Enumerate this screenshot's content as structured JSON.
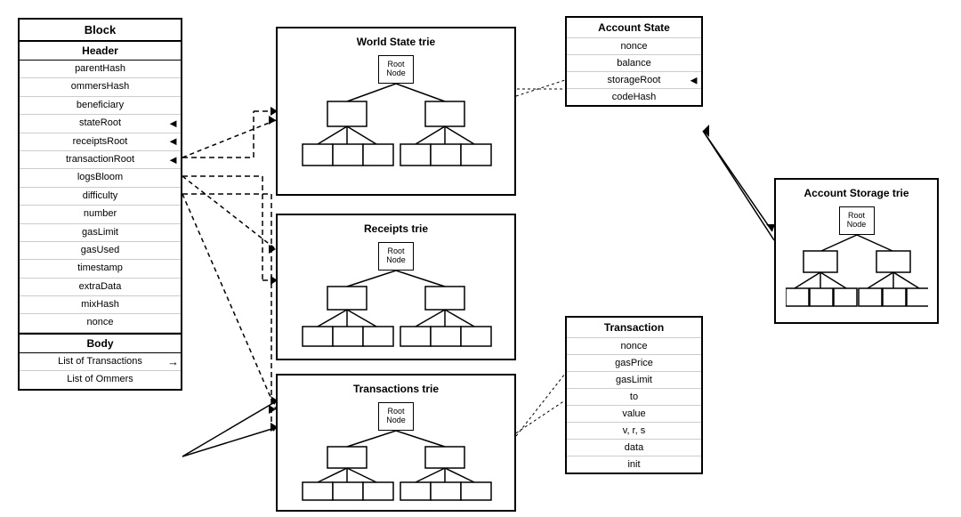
{
  "block": {
    "title": "Block",
    "header": {
      "label": "Header",
      "fields": [
        "parentHash",
        "ommersHash",
        "beneficiary",
        "stateRoot",
        "receiptsRoot",
        "transactionRoot",
        "logsBloom",
        "difficulty",
        "number",
        "gasLimit",
        "gasUsed",
        "timestamp",
        "extraData",
        "mixHash",
        "nonce"
      ]
    },
    "body": {
      "label": "Body",
      "fields": [
        "List of Transactions",
        "List of Ommers"
      ]
    }
  },
  "worldStateTrie": {
    "title": "World State trie",
    "rootLabel": "Root\nNode"
  },
  "receiptsTrie": {
    "title": "Receipts trie",
    "rootLabel": "Root\nNode"
  },
  "transactionsTrie": {
    "title": "Transactions trie",
    "rootLabel": "Root\nNode"
  },
  "accountState": {
    "title": "Account State",
    "fields": [
      "nonce",
      "balance",
      "storageRoot",
      "codeHash"
    ]
  },
  "accountStorageTrie": {
    "title": "Account Storage trie",
    "rootLabel": "Root\nNode"
  },
  "transaction": {
    "title": "Transaction",
    "fields": [
      "nonce",
      "gasPrice",
      "gasLimit",
      "to",
      "value",
      "v, r, s",
      "data",
      "init"
    ]
  }
}
